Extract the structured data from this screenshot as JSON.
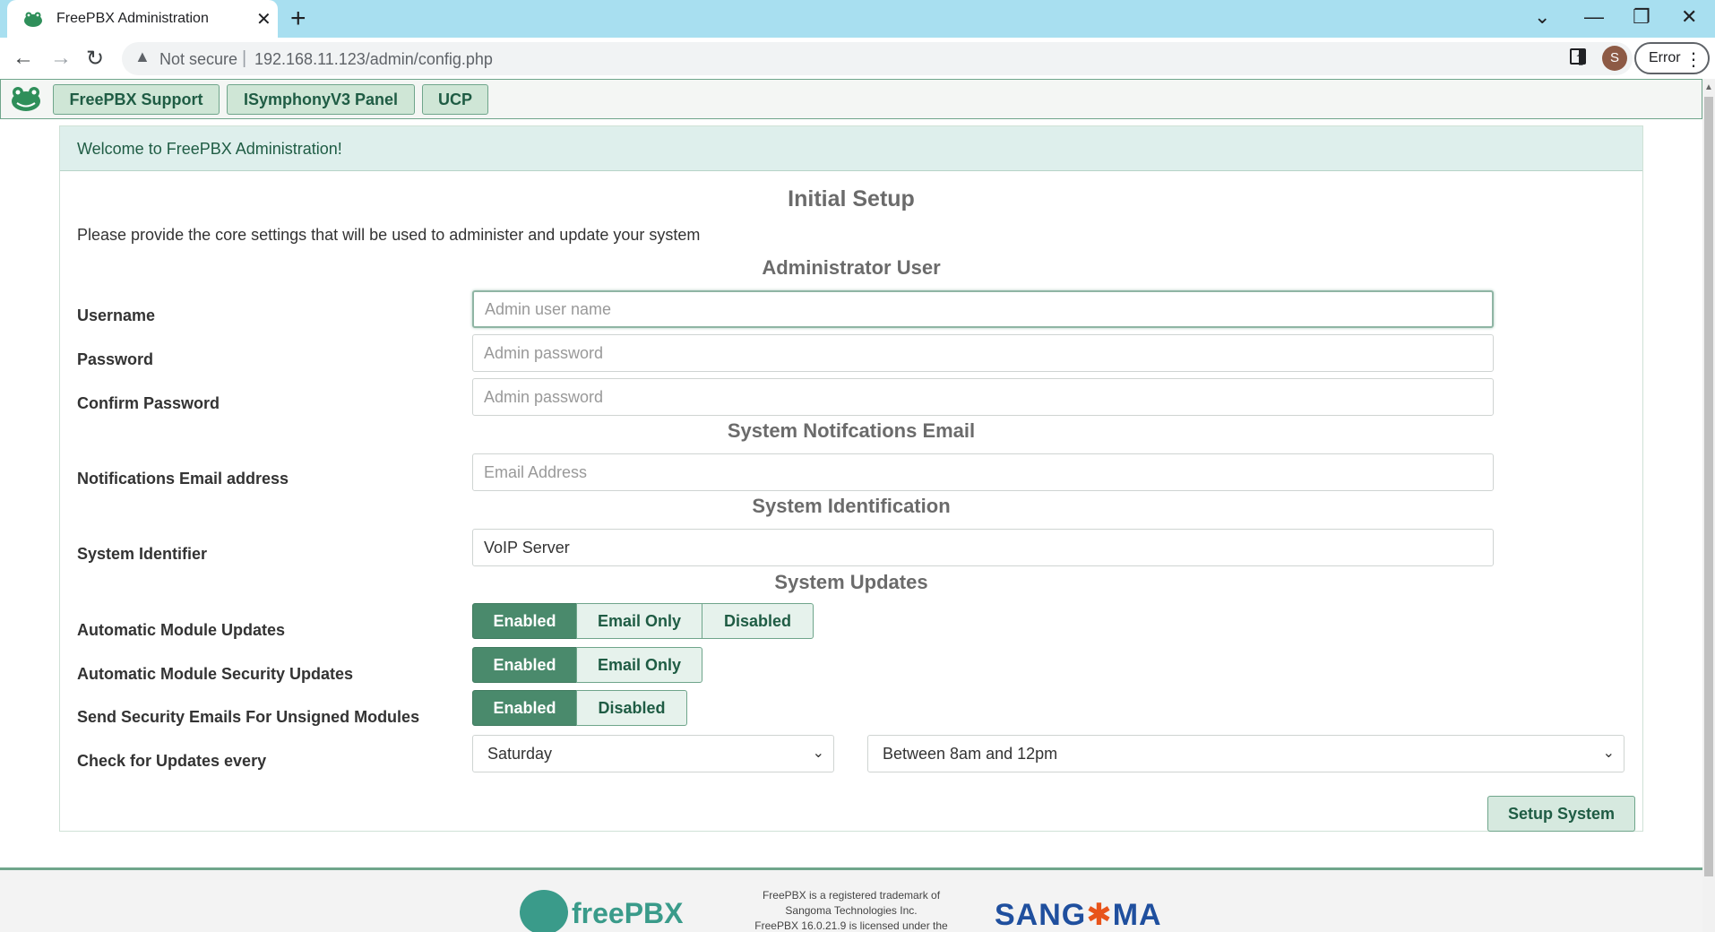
{
  "browser": {
    "tab_title": "FreePBX Administration",
    "tab_close": "✕",
    "new_tab": "+",
    "not_secure": "Not secure",
    "url": "192.168.11.123/admin/config.php",
    "profile_initial": "S",
    "error_label": "Error",
    "window_controls": {
      "dropdown": "⌄",
      "minimize": "—",
      "restore": "❐",
      "close": "✕"
    }
  },
  "topnav": {
    "buttons": [
      "FreePBX Support",
      "ISymphonyV3 Panel",
      "UCP"
    ]
  },
  "panel": {
    "header": "Welcome to FreePBX Administration!",
    "title": "Initial Setup",
    "intro": "Please provide the core settings that will be used to administer and update your system"
  },
  "sections": {
    "admin_user": "Administrator User",
    "notifications": "System Notifcations Email",
    "identification": "System Identification",
    "updates": "System Updates"
  },
  "fields": {
    "username": {
      "label": "Username",
      "placeholder": "Admin user name",
      "value": ""
    },
    "password": {
      "label": "Password",
      "placeholder": "Admin password",
      "value": ""
    },
    "confirm_password": {
      "label": "Confirm Password",
      "placeholder": "Admin password",
      "value": ""
    },
    "email": {
      "label": "Notifications Email address",
      "placeholder": "Email Address",
      "value": ""
    },
    "system_identifier": {
      "label": "System Identifier",
      "placeholder": "",
      "value": "VoIP Server"
    }
  },
  "updates": {
    "auto_module": {
      "label": "Automatic Module Updates",
      "options": [
        "Enabled",
        "Email Only",
        "Disabled"
      ],
      "selected": "Enabled"
    },
    "auto_security": {
      "label": "Automatic Module Security Updates",
      "options": [
        "Enabled",
        "Email Only"
      ],
      "selected": "Enabled"
    },
    "unsigned_emails": {
      "label": "Send Security Emails For Unsigned Modules",
      "options": [
        "Enabled",
        "Disabled"
      ],
      "selected": "Enabled"
    },
    "check_every": {
      "label": "Check for Updates every",
      "day": "Saturday",
      "time": "Between 8am and 12pm"
    }
  },
  "setup_button": "Setup System",
  "footer": {
    "freepbx_logo": "freePBX",
    "legal_lines": [
      "FreePBX is a registered trademark of",
      "Sangoma Technologies Inc.",
      "FreePBX 16.0.21.9 is licensed under the"
    ],
    "sangoma_logo_left": "SANG",
    "sangoma_logo_mark": "✱",
    "sangoma_logo_right": "MA"
  },
  "colors": {
    "accent": "#4a8a6c",
    "header_bg": "#deefec",
    "brand_text": "#1f5c44",
    "tab_strip": "#a8dff0"
  }
}
